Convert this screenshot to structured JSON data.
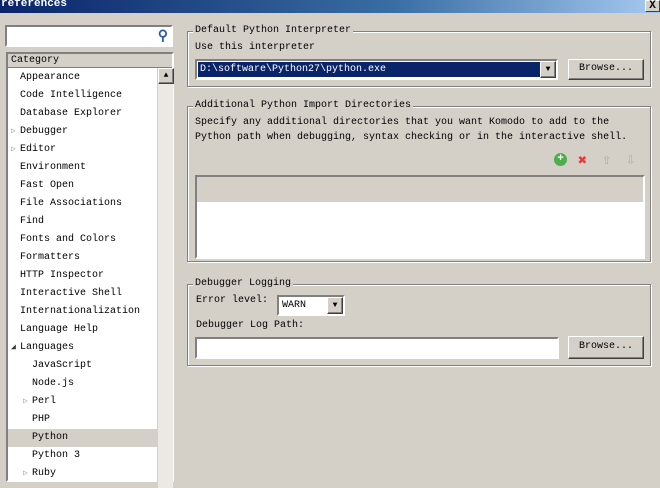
{
  "window": {
    "title": "references",
    "close": "X"
  },
  "search": {
    "placeholder": "",
    "value": ""
  },
  "category": {
    "header": "Category",
    "items": [
      {
        "label": "Appearance",
        "indent": 0,
        "expander": ""
      },
      {
        "label": "Code Intelligence",
        "indent": 0,
        "expander": ""
      },
      {
        "label": "Database Explorer",
        "indent": 0,
        "expander": ""
      },
      {
        "label": "Debugger",
        "indent": 0,
        "expander": "collapsed"
      },
      {
        "label": "Editor",
        "indent": 0,
        "expander": "collapsed"
      },
      {
        "label": "Environment",
        "indent": 0,
        "expander": ""
      },
      {
        "label": "Fast Open",
        "indent": 0,
        "expander": ""
      },
      {
        "label": "File Associations",
        "indent": 0,
        "expander": ""
      },
      {
        "label": "Find",
        "indent": 0,
        "expander": ""
      },
      {
        "label": "Fonts and Colors",
        "indent": 0,
        "expander": ""
      },
      {
        "label": "Formatters",
        "indent": 0,
        "expander": ""
      },
      {
        "label": "HTTP Inspector",
        "indent": 0,
        "expander": ""
      },
      {
        "label": "Interactive Shell",
        "indent": 0,
        "expander": ""
      },
      {
        "label": "Internationalization",
        "indent": 0,
        "expander": ""
      },
      {
        "label": "Language Help",
        "indent": 0,
        "expander": ""
      },
      {
        "label": "Languages",
        "indent": 0,
        "expander": "expanded"
      },
      {
        "label": "JavaScript",
        "indent": 1,
        "expander": ""
      },
      {
        "label": "Node.js",
        "indent": 1,
        "expander": ""
      },
      {
        "label": "Perl",
        "indent": 1,
        "expander": "collapsed"
      },
      {
        "label": "PHP",
        "indent": 1,
        "expander": ""
      },
      {
        "label": "Python",
        "indent": 1,
        "expander": "",
        "selected": true
      },
      {
        "label": "Python 3",
        "indent": 1,
        "expander": ""
      },
      {
        "label": "Ruby",
        "indent": 1,
        "expander": "collapsed"
      }
    ]
  },
  "interpreter": {
    "title": "Default Python Interpreter",
    "label": "Use this interpreter",
    "value": "D:\\software\\Python27\\python.exe",
    "browse": "Browse..."
  },
  "imports": {
    "title": "Additional Python Import Directories",
    "description_line1": "Specify any additional directories that you want Komodo to add to the",
    "description_line2": "Python path when debugging, syntax checking or in the interactive shell."
  },
  "logging": {
    "title": "Debugger Logging",
    "error_label": "Error level:",
    "error_value": "WARN",
    "path_label": "Debugger Log Path:",
    "path_value": "",
    "browse": "Browse..."
  }
}
